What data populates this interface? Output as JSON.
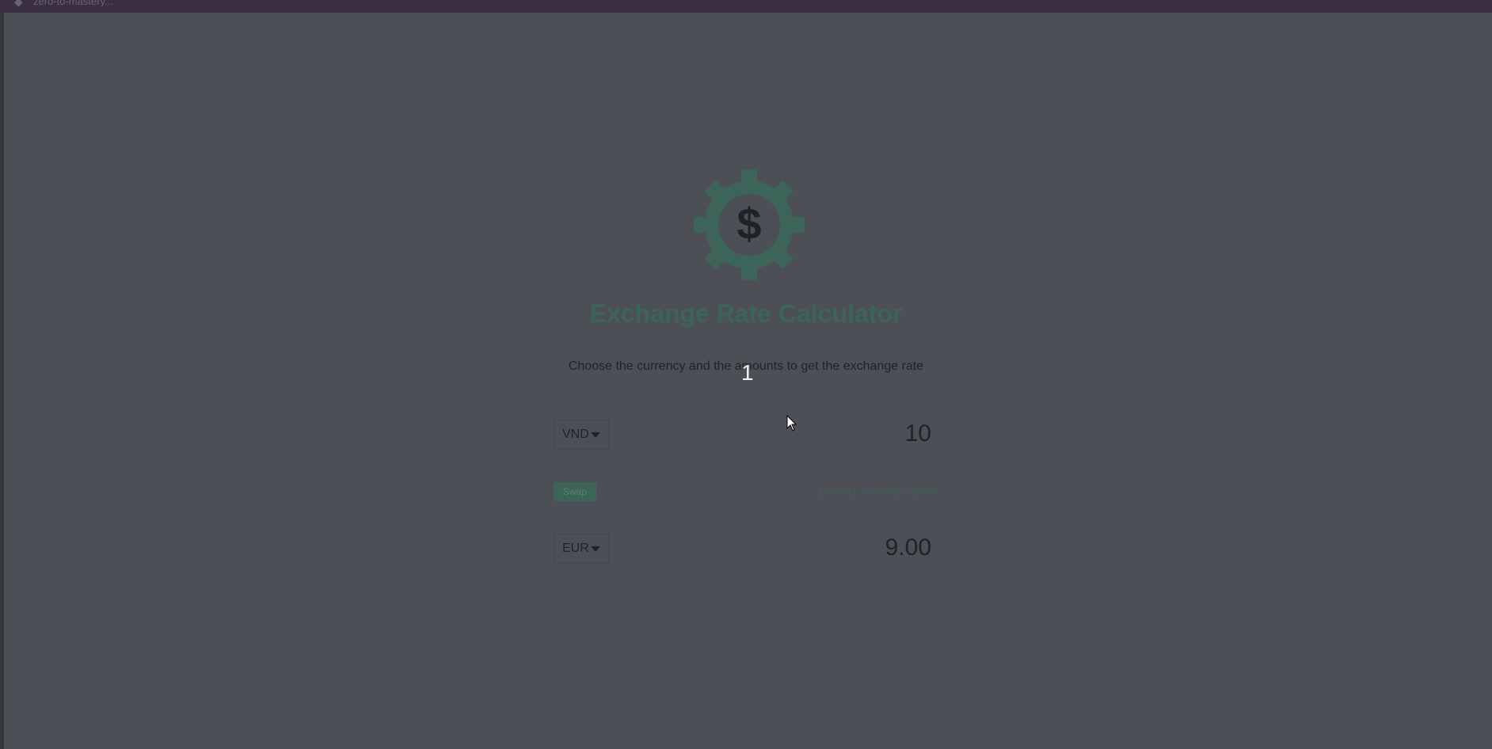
{
  "window": {
    "title": "zero-to-mastery..."
  },
  "app": {
    "title": "Exchange Rate Calculator",
    "subtitle": "Choose the currency and the amounts to get the exchange rate",
    "logo_icon": "gear-dollar-icon",
    "accent_color": "#3d6458"
  },
  "overlay": {
    "digit": "1"
  },
  "converter": {
    "from": {
      "currency": "VND",
      "amount": "10"
    },
    "swap_label": "Swap",
    "rate_text": "10 USD = 0.90027 EUR",
    "to": {
      "currency": "EUR",
      "amount": "9.00"
    }
  }
}
